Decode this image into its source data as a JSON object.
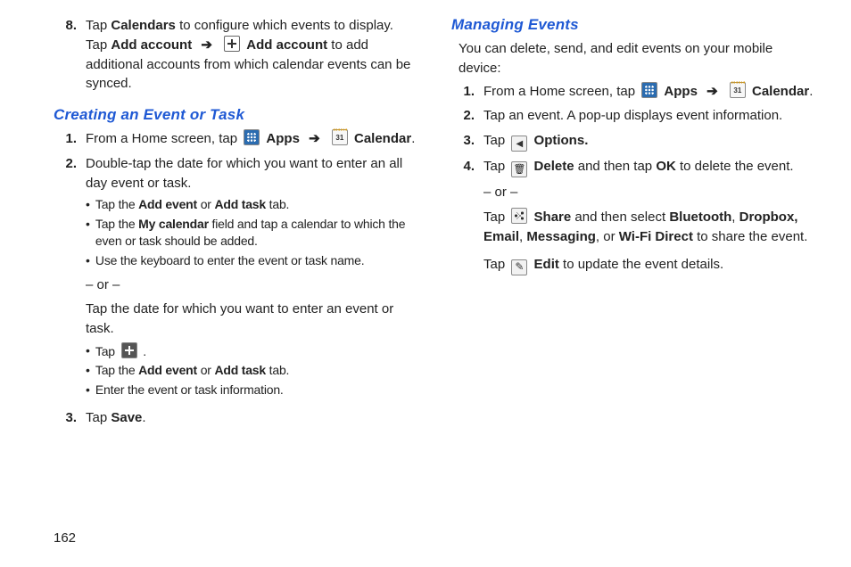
{
  "pageNumber": "162",
  "arrow": "➔",
  "left": {
    "pre": {
      "num": "8.",
      "line1a": "Tap ",
      "line1b": "Calendars",
      "line1c": " to configure which events to display.",
      "line2a": "Tap ",
      "line2b": "Add account",
      "line2c": "Add account",
      "line2d": " to add additional accounts from which calendar events can be synced."
    },
    "headingCreate": "Creating an Event or Task",
    "create": {
      "n1": {
        "num": "1.",
        "a": "From a Home screen, tap ",
        "apps": "Apps",
        "cal": "Calendar",
        "end": "."
      },
      "n2": {
        "num": "2.",
        "text": "Double-tap the date for which you want to enter an all day event or task.",
        "b1a": "Tap the ",
        "b1b": "Add event",
        "b1c": " or ",
        "b1d": "Add task",
        "b1e": " tab.",
        "b2a": "Tap the ",
        "b2b": "My calendar",
        "b2c": " field and tap a calendar to which the even or task should be added.",
        "b3": "Use the keyboard to enter the event or task name.",
        "or": "– or –",
        "dateText": "Tap the date for which you want to enter an event or task.",
        "b4": "Tap ",
        "b5a": "Tap the ",
        "b5b": "Add event",
        "b5c": " or ",
        "b5d": "Add task",
        "b5e": " tab.",
        "b6": "Enter the event or task information."
      },
      "n3": {
        "num": "3.",
        "a": "Tap ",
        "b": "Save",
        "c": "."
      }
    }
  },
  "right": {
    "headingManage": "Managing Events",
    "intro": "You can delete, send, and edit events on your mobile device:",
    "m1": {
      "num": "1.",
      "a": "From a Home screen, tap ",
      "apps": "Apps",
      "cal": "Calendar",
      "end": "."
    },
    "m2": {
      "num": "2.",
      "text": "Tap an event. A pop-up displays event information."
    },
    "m3": {
      "num": "3.",
      "a": "Tap ",
      "b": "Options."
    },
    "m4": {
      "num": "4.",
      "del_a": "Tap ",
      "del_b": "Delete",
      "del_c": " and then tap ",
      "del_d": "OK",
      "del_e": " to delete the event.",
      "or": "– or –",
      "share_a": "Tap ",
      "share_b": "Share",
      "share_c": " and then select ",
      "share_d": "Bluetooth",
      "share_e": ", ",
      "share_f": "Dropbox,",
      "share_g": " ",
      "share_h": "Email",
      "share_i": ", ",
      "share_j": "Messaging",
      "share_k": ", or ",
      "share_l": "Wi-Fi Direct",
      "share_m": " to share the event.",
      "edit_a": "Tap ",
      "edit_b": "Edit",
      "edit_c": " to update the event details."
    }
  }
}
